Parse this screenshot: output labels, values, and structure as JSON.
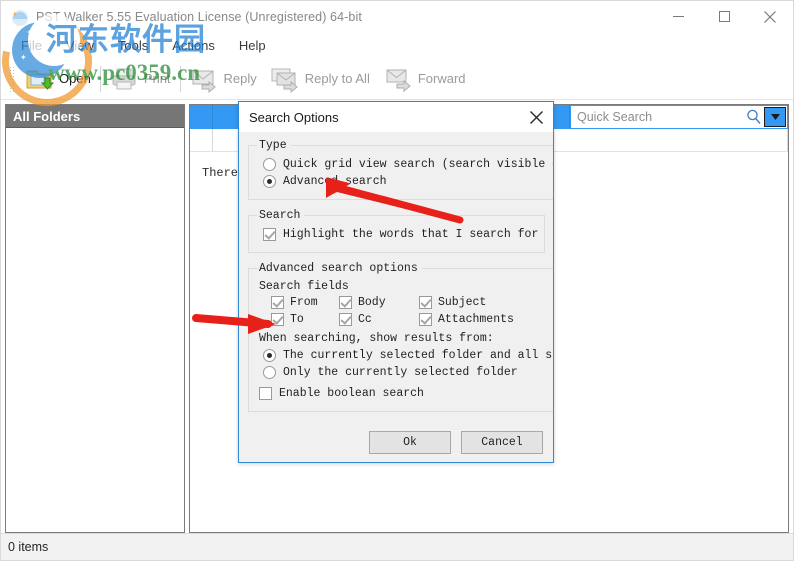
{
  "window": {
    "title": "PST Walker 5.55 Evaluation License (Unregistered) 64-bit",
    "icon": "app-icon",
    "controls": {
      "minimize": "—",
      "maximize": "☐",
      "close": "✕"
    }
  },
  "menubar": {
    "items": [
      {
        "label": "File"
      },
      {
        "label": "View"
      },
      {
        "label": "Tools"
      },
      {
        "label": "Actions"
      },
      {
        "label": "Help"
      }
    ]
  },
  "toolbar": {
    "buttons": [
      {
        "label": "Open",
        "icon": "open-folder-icon",
        "enabled": true
      },
      {
        "label": "Print",
        "icon": "printer-icon",
        "enabled": false
      },
      {
        "label": "Reply",
        "icon": "reply-envelope-icon",
        "enabled": false
      },
      {
        "label": "Reply to All",
        "icon": "reply-all-envelope-icon",
        "enabled": false
      },
      {
        "label": "Forward",
        "icon": "forward-envelope-icon",
        "enabled": false
      }
    ]
  },
  "sidebar": {
    "header": "All Folders",
    "items": []
  },
  "main": {
    "search": {
      "placeholder": "Quick Search",
      "value": "",
      "magnifier_icon": "magnifier-icon",
      "dropdown_icon": "chevron-down-icon",
      "accent_color": "#3399f3"
    },
    "empty_message": "There are no items to show in this view."
  },
  "statusbar": {
    "text": "0 items"
  },
  "watermark": {
    "site_name": "河东软件园",
    "url": "www.pc0359.cn",
    "name_color": "#1e7fd4",
    "url_color": "#1f8a2f"
  },
  "dialog": {
    "title": "Search Options",
    "close_icon": "close-icon",
    "border_color": "#2e8ad6",
    "groups": {
      "type": {
        "legend": "Type",
        "options": [
          {
            "label": "Quick grid view search (search visible columns)",
            "selected": false
          },
          {
            "label": "Advanced search",
            "selected": true
          }
        ]
      },
      "search": {
        "legend": "Search",
        "options": [
          {
            "label": "Highlight the words that I search for",
            "checked": true
          }
        ]
      },
      "advanced": {
        "legend": "Advanced search options",
        "fields_label": "Search fields",
        "fields": [
          {
            "label": "From",
            "checked": true
          },
          {
            "label": "Body",
            "checked": true
          },
          {
            "label": "Subject",
            "checked": true
          },
          {
            "label": "To",
            "checked": true
          },
          {
            "label": "Cc",
            "checked": true
          },
          {
            "label": "Attachments",
            "checked": true
          }
        ],
        "scope_label": "When searching, show results from:",
        "scope_options": [
          {
            "label": "The currently selected folder and all subfolders",
            "selected": true
          },
          {
            "label": "Only the currently selected folder",
            "selected": false
          }
        ],
        "boolean_option": {
          "label": "Enable boolean search",
          "checked": false
        }
      }
    },
    "buttons": {
      "ok": "Ok",
      "cancel": "Cancel"
    }
  },
  "annotations": {
    "arrow_color": "#e8201a",
    "arrows": [
      {
        "name": "arrow-to-advanced-search",
        "points_to": "Advanced search"
      },
      {
        "name": "arrow-to-search-fields",
        "points_to": "To checkbox"
      }
    ]
  }
}
